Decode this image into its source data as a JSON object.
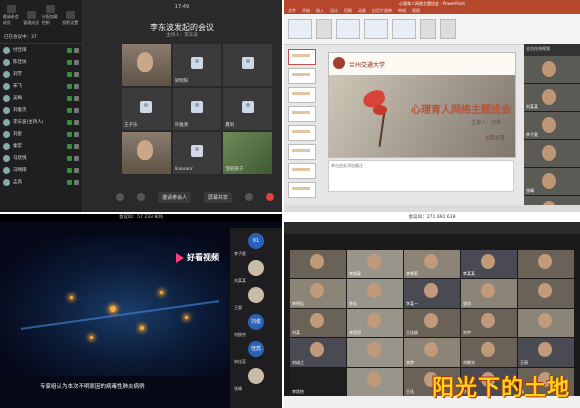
{
  "meeting_tl": {
    "clock": "17:49",
    "title": "李东波发起的会议",
    "subtitle": "主持人：李东波",
    "sidebar_top": [
      "邀请参会成员",
      "管理成员",
      "分配加载控制",
      "投影设置"
    ],
    "sidebar_heading": "已在会议中：37",
    "participants": [
      "付佳琦",
      "陈佳坊",
      "刘芳",
      "宋飞",
      "吴梅",
      "刘俊杰",
      "李东波(主持人)",
      "刘星",
      "秦宏",
      "马欣悦",
      "马晴雨",
      "孟高"
    ],
    "tiles": [
      "",
      "梁明阳",
      "",
      "王子乐",
      "许雅清",
      "鑫钊",
      "",
      "linkuanr",
      "邹丽嘉子"
    ],
    "controls": [
      "静音",
      "开启视频",
      "邀请参会人",
      "屏幕共享",
      "更多",
      "结束"
    ],
    "meeting_id": "会议ID：57 233 806"
  },
  "ppt": {
    "window_title": "心理育人网络主题班会 - PowerPoint",
    "menu": [
      "文件",
      "开始",
      "插入",
      "设计",
      "切换",
      "动画",
      "幻灯片放映",
      "审阅",
      "视图"
    ],
    "slide_title": "心理育人网络主题班会",
    "school_name": "兰州交通大学",
    "slide_sub": "主讲人：刘某",
    "slide_sub2": "X年8月",
    "notes_hint": "单击此处添加备注",
    "video_names": [
      "",
      "刘某某",
      "李子夏",
      "",
      "张晴",
      "王某"
    ],
    "video_heading": "全员在线视频"
  },
  "video_bl": {
    "meeting_id": "会议ID：57 233 806",
    "brand": "好看视频",
    "caption": "专家组认为本次不明原因的病毒性肺炎病例",
    "side": [
      {
        "label": "01",
        "name": "李子夏"
      },
      {
        "label": "",
        "name": "刘某某"
      },
      {
        "label": "",
        "name": "王超"
      },
      {
        "label": "刘俊",
        "name": "刘俊杰"
      },
      {
        "label": "佳蕊",
        "name": "宋佳蕊"
      },
      {
        "label": "",
        "name": "张晴"
      }
    ]
  },
  "meeting_br": {
    "meeting_id": "会议ID：271 691 619",
    "names": [
      "",
      "李俊豪",
      "李晓莉",
      "李某某",
      "",
      "李明远",
      "李佳",
      "李某一",
      "张欣",
      "",
      "刘某",
      "李思思",
      "王佳俊",
      "刘宇",
      "",
      "刘成之",
      "",
      "李梦",
      "刘晓光",
      "王雨",
      "李欣怡",
      "",
      "王佳",
      "李然",
      "鑫"
    ],
    "watermark": "阳光下的土地"
  }
}
